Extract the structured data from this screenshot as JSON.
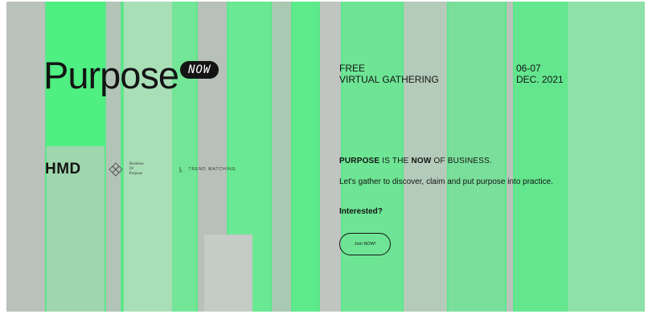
{
  "logo": {
    "word": "Purpose",
    "pill": "NOW"
  },
  "sponsors": {
    "hmd": "HMD",
    "bop_lines": [
      "Business",
      "Of",
      "Purpose"
    ],
    "trendwatching": "TREND WATCHING"
  },
  "event": {
    "type_line1": "FREE",
    "type_line2": "VIRTUAL GATHERING",
    "date_line1": "06-07",
    "date_line2": "DEC. 2021"
  },
  "headline": {
    "part1": "PURPOSE",
    "part2": " IS THE ",
    "part3": "NOW",
    "part4": " OF BUSINESS."
  },
  "description": "Let's gather to discover, claim and put purpose into practice.",
  "interest": "Interested?",
  "cta": {
    "label": "Join NOW!"
  },
  "colors": {
    "green": "#5ee58c",
    "grey": "#b9c2bb",
    "ink": "#141414"
  }
}
